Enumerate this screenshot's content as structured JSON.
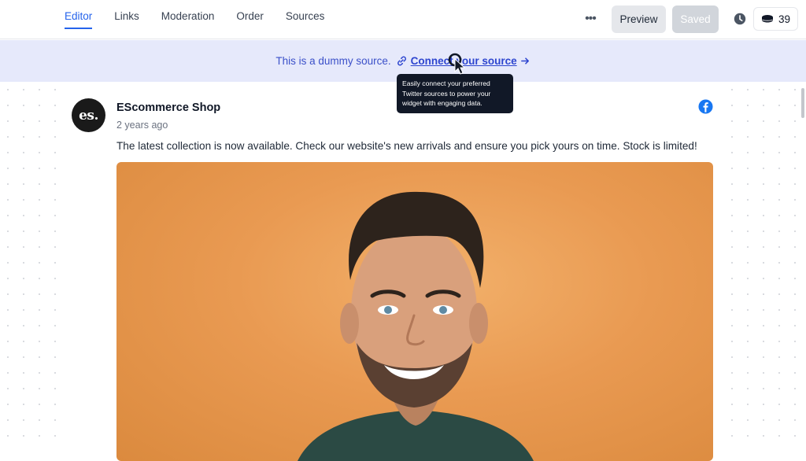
{
  "tabs": [
    {
      "label": "Editor",
      "active": true
    },
    {
      "label": "Links",
      "active": false
    },
    {
      "label": "Moderation",
      "active": false
    },
    {
      "label": "Order",
      "active": false
    },
    {
      "label": "Sources",
      "active": false
    }
  ],
  "toolbar": {
    "more_label": "•••",
    "preview_label": "Preview",
    "saved_label": "Saved",
    "credits_count": "39"
  },
  "banner": {
    "text": "This is a dummy source.",
    "link_label": "Connect your source"
  },
  "tooltip": {
    "text": "Easily connect your preferred Twitter sources to power your widget with engaging data."
  },
  "post": {
    "avatar_text": "es.",
    "author": "EScommerce Shop",
    "time": "2 years ago",
    "text": "The latest collection is now available. Check our website's new arrivals and ensure you pick yours on time. Stock is limited!",
    "source_icon": "facebook-icon"
  },
  "colors": {
    "accent": "#2563eb",
    "banner_bg": "#e6e9fb",
    "facebook": "#1877f2"
  }
}
